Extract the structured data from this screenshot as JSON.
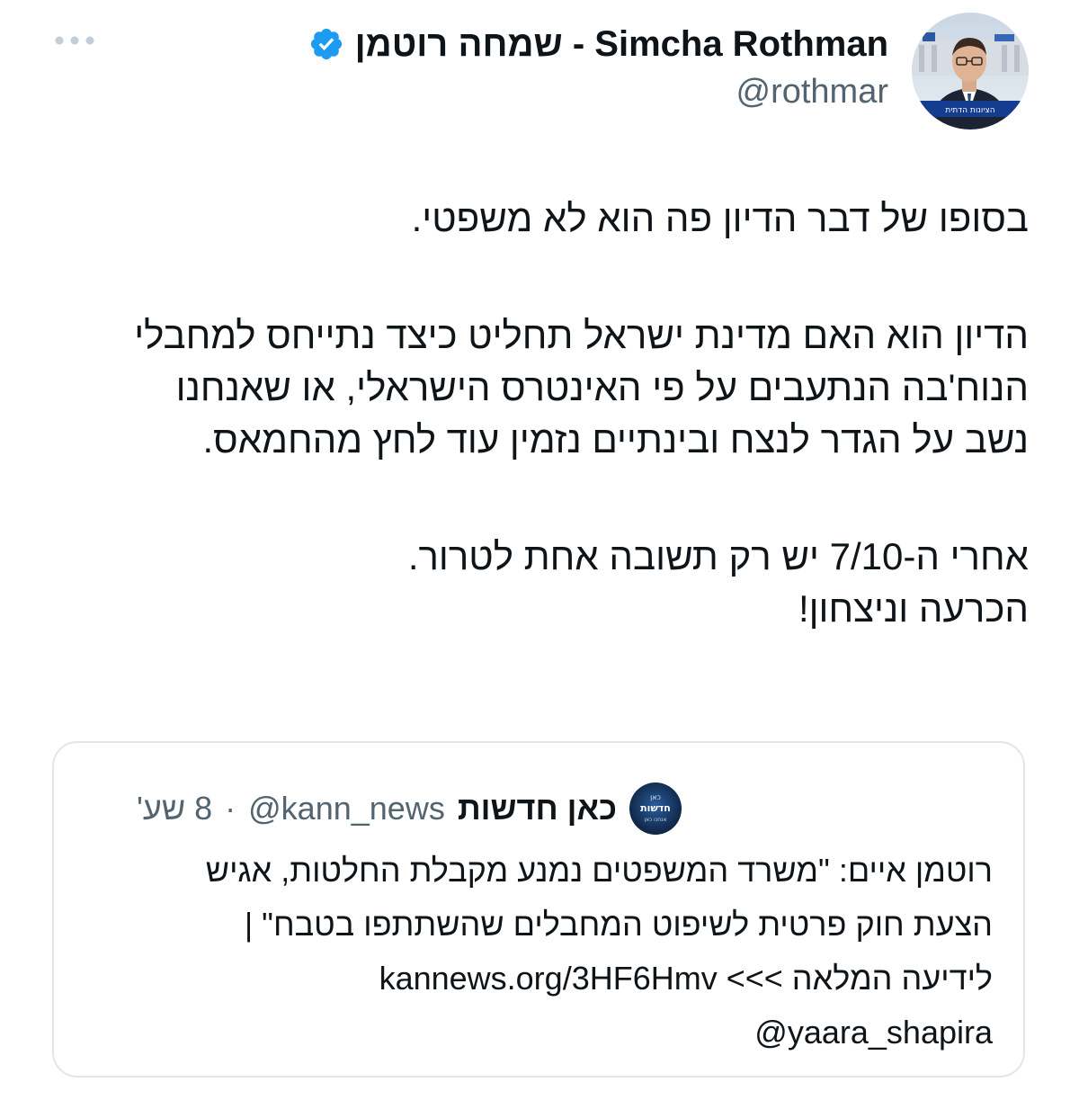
{
  "header": {
    "display_name": "שמחה רוטמן - Simcha Rothman",
    "handle": "@rothmar",
    "verified": true,
    "more_icon": "more-horizontal-icon",
    "verified_icon": "verified-badge-icon",
    "avatar_banner_text": "הציונות הדתית"
  },
  "tweet": {
    "line1": "בסופו של דבר הדיון פה הוא לא משפטי.",
    "line2": "הדיון הוא האם מדינת ישראל תחליט כיצד נתייחס למחבלי",
    "line3": "הנוח'בה הנתעבים על פי האינטרס הישראלי, או שאנחנו",
    "line4": "נשב על הגדר לנצח ובינתיים נזמין עוד לחץ מהחמאס.",
    "line5": "אחרי ה-7/10 יש רק תשובה אחת לטרור.",
    "line6": "הכרעה וניצחון!"
  },
  "quote": {
    "name": "כאן חדשות",
    "handle": "@kann_news",
    "separator": "·",
    "time": "8 שע'",
    "avatar_text_top": "כאן",
    "avatar_text_main": "חדשות",
    "avatar_text_bottom": "אנחנו כאן",
    "line1": "רוטמן איים: \"משרד המשפטים נמנע מקבלת החלטות, אגיש",
    "line2": "הצעת חוק פרטית לשיפוט המחבלים שהשתתפו בטבח\" |",
    "line3_text": "לידיעה המלאה >>>",
    "line3_link": "kannews.org/3HF6Hmv",
    "line4": "@yaara_shapira"
  },
  "colors": {
    "text": "#0f1419",
    "muted": "#536471",
    "verified": "#1d9bf0",
    "border": "#e1e6ea"
  }
}
